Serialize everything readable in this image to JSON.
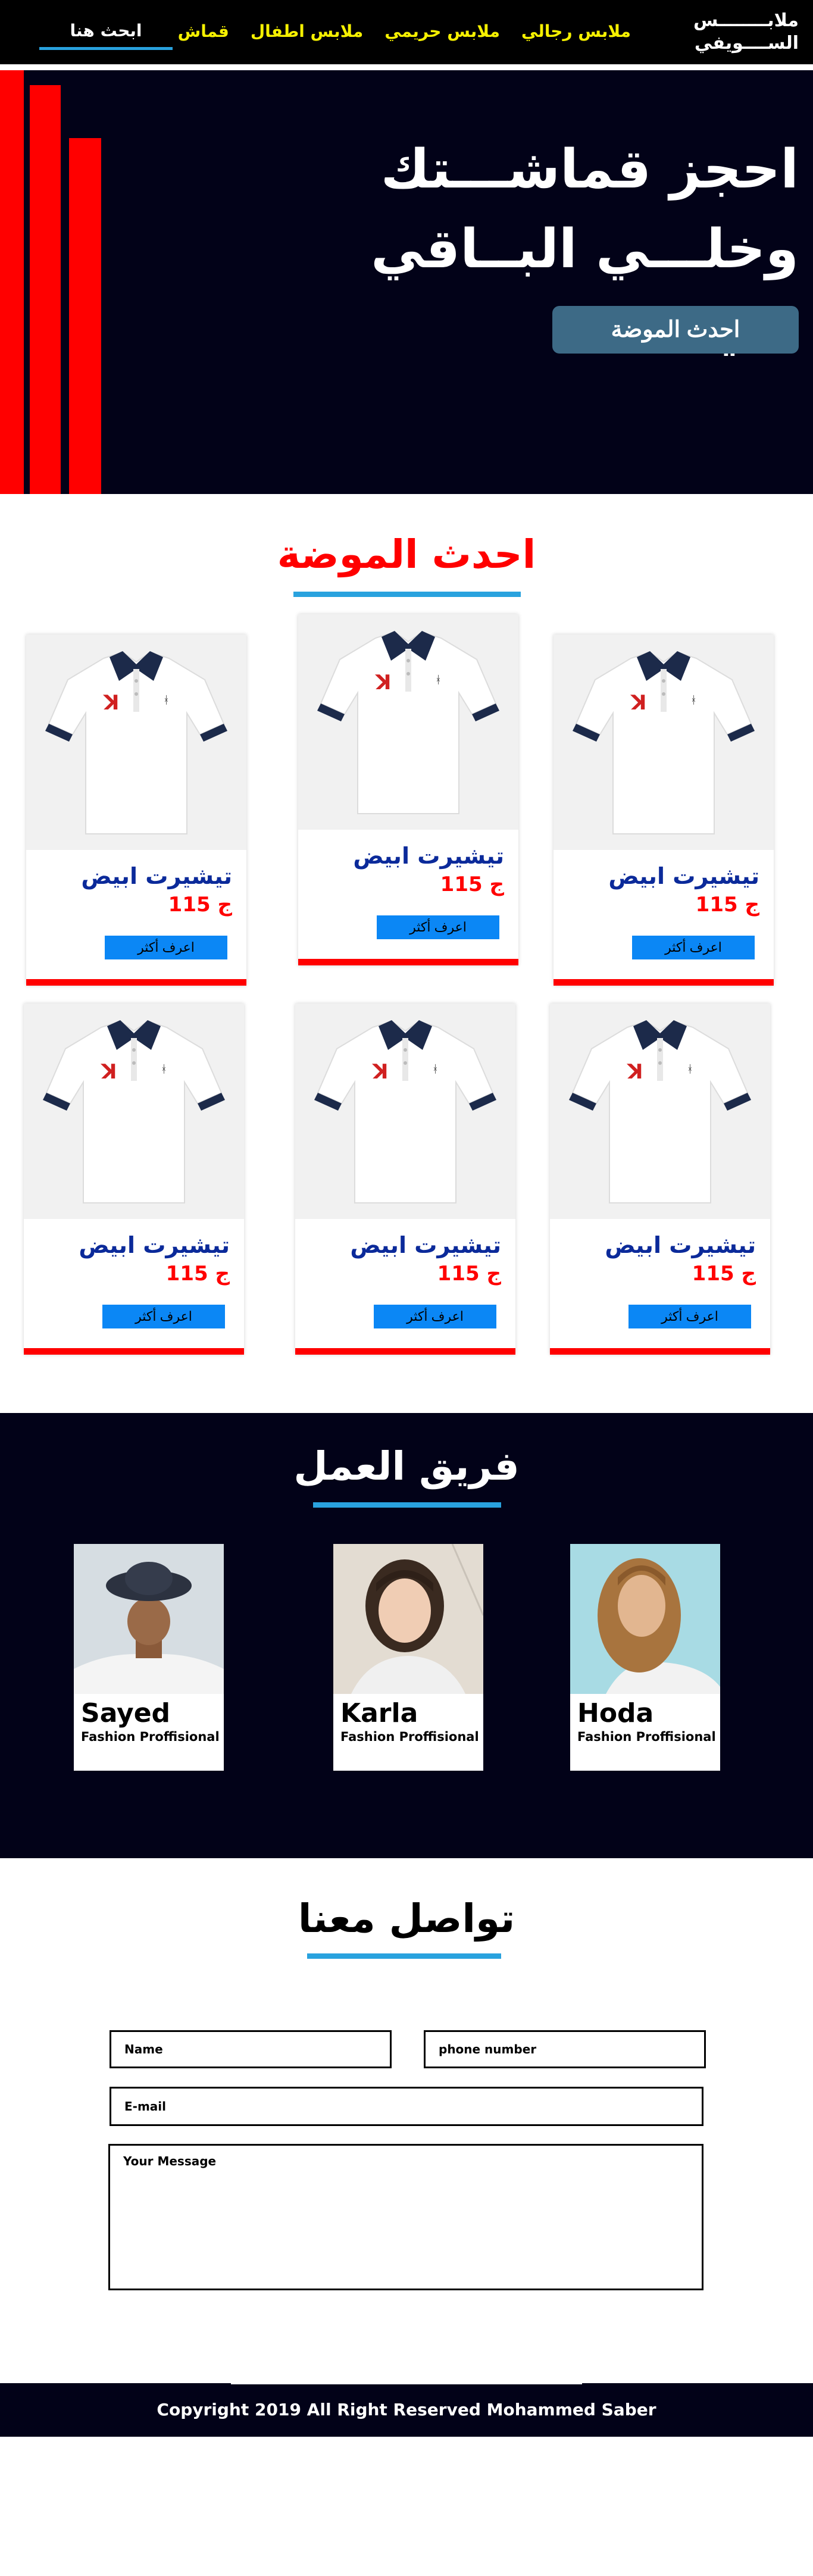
{
  "header": {
    "logo_line1": "ملابــــــــس",
    "logo_line2": "الســــويفي",
    "nav": [
      "ملابس رجالي",
      "ملابس حريمي",
      "ملابس اطفال",
      "قماش"
    ],
    "search_label": "ابحث هنا"
  },
  "hero": {
    "line1": "احجز قماشـــتك",
    "line2": "وخلـــي البــاقي علينا",
    "button": "احدث الموضة"
  },
  "latest": {
    "title": "احدث الموضة",
    "products": [
      {
        "name": "تيشيرت ابيض",
        "price": "115 ج",
        "button": "اعرف أكثر"
      },
      {
        "name": "تيشيرت ابيض",
        "price": "115 ج",
        "button": "اعرف أكثر"
      },
      {
        "name": "تيشيرت ابيض",
        "price": "115 ج",
        "button": "اعرف أكثر"
      },
      {
        "name": "تيشيرت ابيض",
        "price": "115 ج",
        "button": "اعرف أكثر"
      },
      {
        "name": "تيشيرت ابيض",
        "price": "115 ج",
        "button": "اعرف أكثر"
      },
      {
        "name": "تيشيرت ابيض",
        "price": "115 ج",
        "button": "اعرف أكثر"
      }
    ]
  },
  "team": {
    "title": "فريق العمل",
    "members": [
      {
        "name": "Sayed",
        "role": "Fashion Proffisional"
      },
      {
        "name": "Karla",
        "role": "Fashion Proffisional"
      },
      {
        "name": "Hoda",
        "role": "Fashion Proffisional"
      }
    ]
  },
  "contact": {
    "title": "تواصل معنا",
    "name_placeholder": "Name",
    "phone_placeholder": "phone number",
    "email_placeholder": "E-mail",
    "message_placeholder": "Your Message"
  },
  "footer": {
    "copyright": "Copyright 2019 All Right Reserved Mohammed Saber"
  },
  "colors": {
    "accent_red": "#ff0000",
    "nav_yellow": "#f5f000",
    "underline_blue": "#29a2de",
    "dark_navy": "#020218",
    "product_blue": "#0b2a9a"
  }
}
